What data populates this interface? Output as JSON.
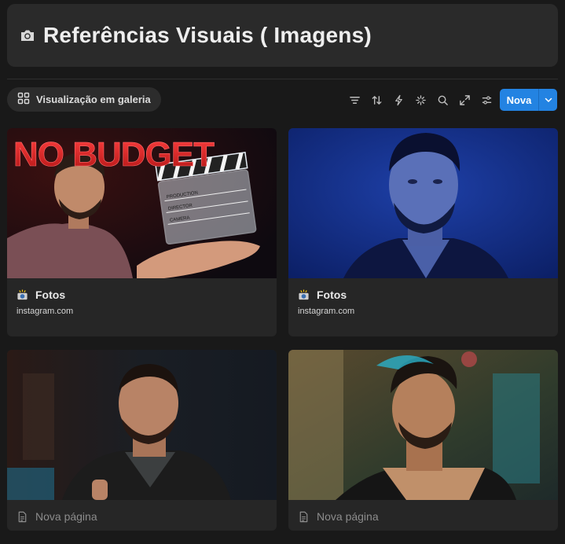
{
  "header": {
    "icon": "camera-icon",
    "title": "Referências Visuais ( Imagens)"
  },
  "toolbar": {
    "view_label": "Visualização em galeria",
    "tools": [
      "filter-icon",
      "sort-icon",
      "automation-icon",
      "ai-sparkle-icon",
      "search-icon",
      "expand-icon",
      "settings-icon"
    ],
    "new_label": "Nova"
  },
  "cards": [
    {
      "image_text": "NO BUDGET",
      "clapper": [
        "PRODUCTION",
        "DIRECTOR",
        "CAMERA"
      ],
      "title": "Fotos",
      "source": "instagram.com"
    },
    {
      "title": "Fotos",
      "source": "instagram.com"
    },
    {
      "title": "Nova página"
    },
    {
      "title": "Nova página"
    }
  ],
  "colors": {
    "accent": "#2383e2",
    "background": "#191919",
    "card": "#262626"
  }
}
